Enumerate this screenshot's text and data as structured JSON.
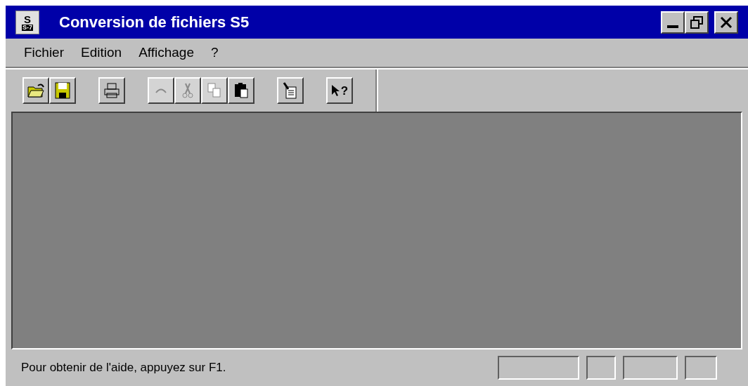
{
  "window": {
    "title": "Conversion de fichiers S5",
    "icon_lines": [
      "S",
      "S-7"
    ]
  },
  "menu": [
    {
      "label": "Fichier"
    },
    {
      "label": "Edition"
    },
    {
      "label": "Affichage"
    },
    {
      "label": "?"
    }
  ],
  "toolbar": {
    "groups": [
      [
        {
          "kind": "open",
          "disabled": false
        },
        {
          "kind": "save",
          "disabled": false
        }
      ],
      [
        {
          "kind": "print",
          "disabled": false
        }
      ],
      [
        {
          "kind": "undo",
          "disabled": true
        },
        {
          "kind": "cut",
          "disabled": true
        },
        {
          "kind": "copy",
          "disabled": true
        },
        {
          "kind": "paste",
          "disabled": false
        }
      ],
      [
        {
          "kind": "document",
          "disabled": false
        }
      ],
      [
        {
          "kind": "help",
          "disabled": false,
          "glyph": "?"
        }
      ]
    ]
  },
  "status_bar": {
    "message": "Pour obtenir de l'aide, appuyez sur F1."
  }
}
